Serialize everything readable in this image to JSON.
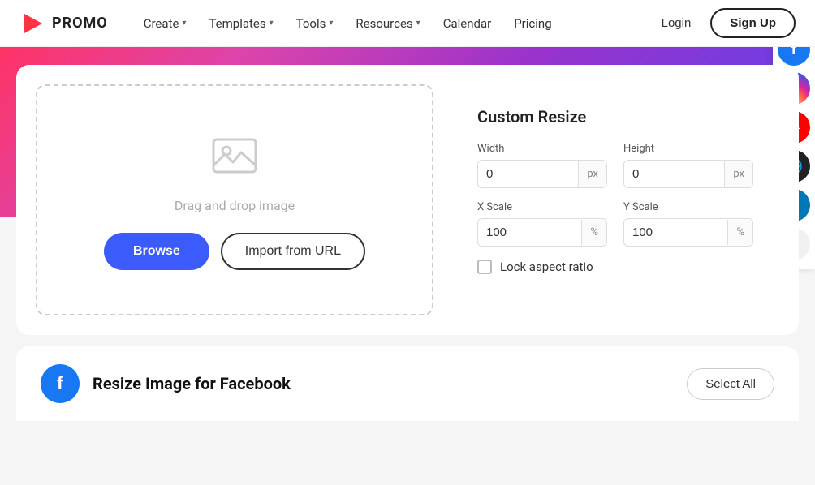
{
  "navbar": {
    "logo_text": "PROMO",
    "nav_items": [
      {
        "label": "Create",
        "has_dropdown": true
      },
      {
        "label": "Templates",
        "has_dropdown": true
      },
      {
        "label": "Tools",
        "has_dropdown": true
      },
      {
        "label": "Resources",
        "has_dropdown": true
      },
      {
        "label": "Calendar",
        "has_dropdown": false
      },
      {
        "label": "Pricing",
        "has_dropdown": false
      }
    ],
    "login_label": "Login",
    "signup_label": "Sign Up"
  },
  "upload_area": {
    "drag_text": "Drag and drop image",
    "browse_label": "Browse",
    "import_label": "Import from URL"
  },
  "resize_panel": {
    "title": "Custom Resize",
    "width_label": "Width",
    "width_value": "0",
    "width_unit": "px",
    "height_label": "Height",
    "height_value": "0",
    "height_unit": "px",
    "xscale_label": "X Scale",
    "xscale_value": "100",
    "xscale_unit": "%",
    "yscale_label": "Y Scale",
    "yscale_value": "100",
    "yscale_unit": "%",
    "lock_label": "Lock aspect ratio"
  },
  "social_sidebar": [
    {
      "id": "facebook",
      "symbol": "f"
    },
    {
      "id": "instagram",
      "symbol": "♥"
    },
    {
      "id": "youtube",
      "symbol": "▶"
    },
    {
      "id": "web",
      "symbol": "🌐"
    },
    {
      "id": "linkedin",
      "symbol": "in"
    },
    {
      "id": "more",
      "symbol": "∨"
    }
  ],
  "bottom_section": {
    "title": "Resize Image for Facebook",
    "select_all_label": "Select All"
  }
}
